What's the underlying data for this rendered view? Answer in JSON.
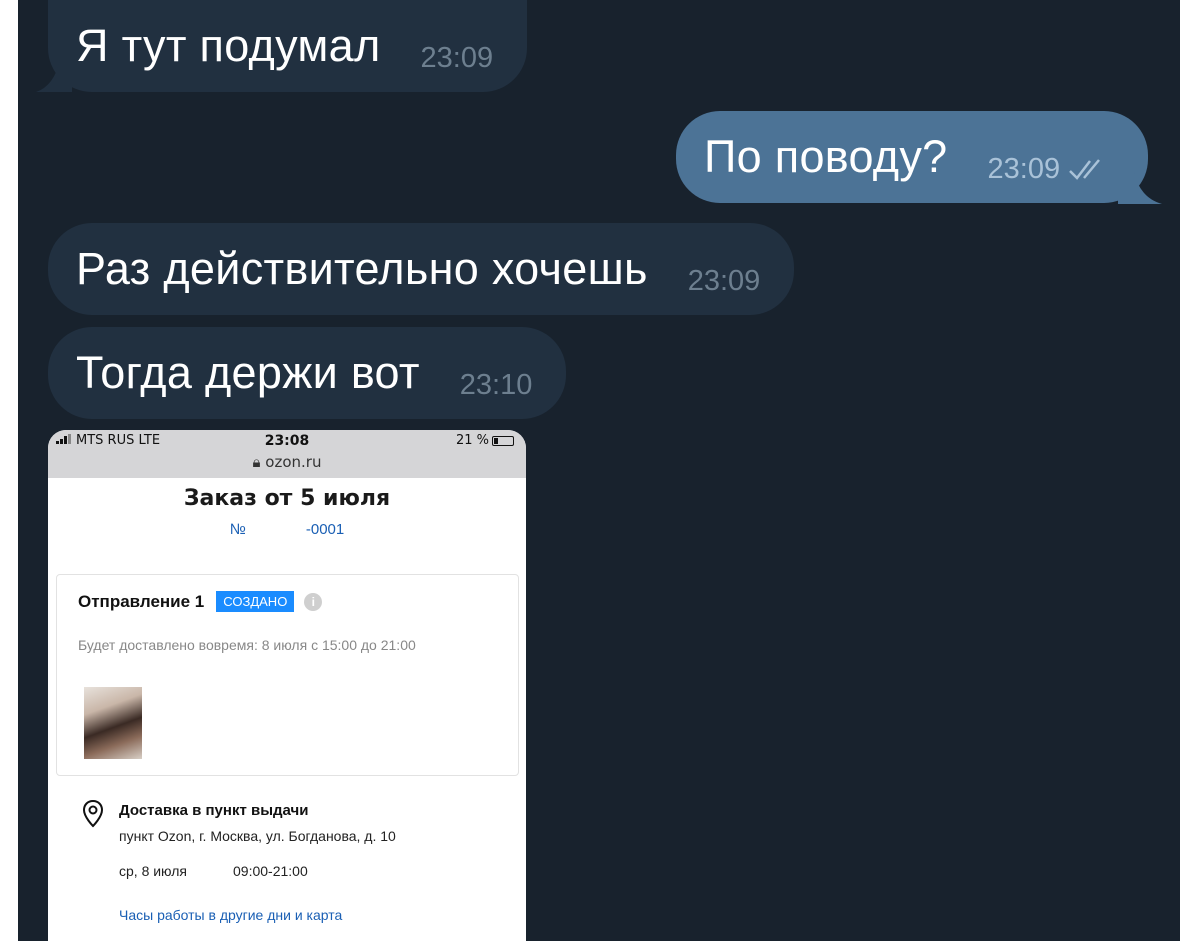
{
  "messages": [
    {
      "text": "Я тут подумал",
      "time": "23:09",
      "direction": "in"
    },
    {
      "text": "По поводу?",
      "time": "23:09",
      "direction": "out",
      "status": "read"
    },
    {
      "text": "Раз действительно хочешь",
      "time": "23:09",
      "direction": "in"
    },
    {
      "text": "Тогда держи вот",
      "time": "23:10",
      "direction": "in"
    }
  ],
  "attachment": {
    "statusbar": {
      "carrier": "MTS RUS  LTE",
      "clock": "23:08",
      "battery": "21 %",
      "url": "ozon.ru"
    },
    "order": {
      "title": "Заказ от 5 июля",
      "num_prefix": "№",
      "num_suffix": "-0001"
    },
    "shipment": {
      "title": "Отправление 1",
      "badge": "СОЗДАНО",
      "info_icon": "i",
      "delivery_time": "Будет доставлено вовремя: 8 июля с 15:00 до 21:00"
    },
    "delivery": {
      "title": "Доставка в пункт выдачи",
      "address": "пункт Ozon, г. Москва, ул. Богданова, д. 10",
      "date": "ср, 8 июля",
      "hours": "09:00-21:00",
      "hours_link": "Часы работы в другие дни и карта"
    }
  },
  "colors": {
    "chat_bg": "#18222d",
    "incoming_bubble": "#213040",
    "outgoing_bubble": "#4c7396",
    "badge": "#1a8cff",
    "link": "#1a5fb4"
  }
}
